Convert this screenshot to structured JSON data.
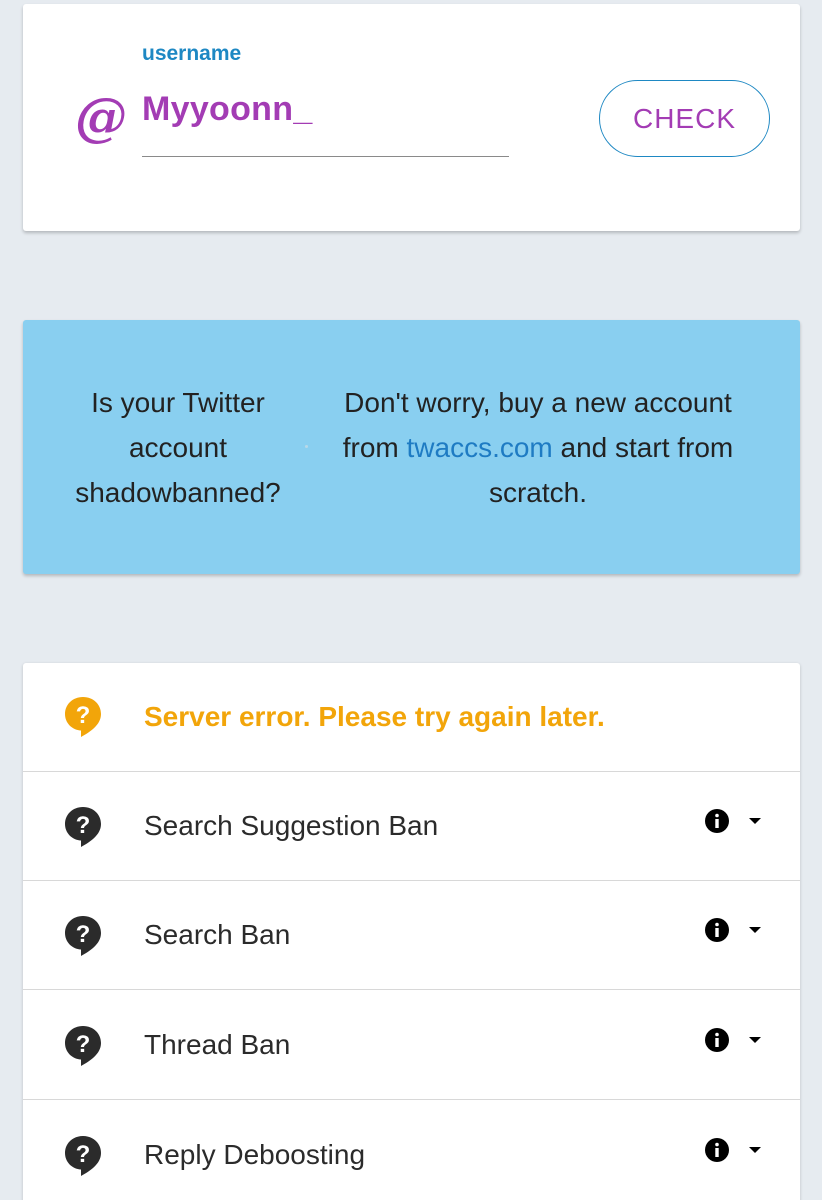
{
  "username_form": {
    "label": "username",
    "value": "Myyoonn_",
    "at_symbol": "@",
    "check_label": "CHECK"
  },
  "ad": {
    "left_text": "Is your Twitter account shadowbanned?",
    "right_text_before": "Don't worry, buy a new account from ",
    "right_link": "twaccs.com",
    "right_text_after": " and start from scratch."
  },
  "results": {
    "status_message": "Server error. Please try again later.",
    "items": [
      {
        "label": "Search Suggestion Ban",
        "icon": "question-bubble-icon"
      },
      {
        "label": "Search Ban",
        "icon": "question-bubble-icon"
      },
      {
        "label": "Thread Ban",
        "icon": "question-bubble-icon"
      },
      {
        "label": "Reply Deboosting",
        "icon": "question-bubble-icon"
      }
    ]
  },
  "colors": {
    "background": "#e6ebf0",
    "accent_purple": "#a33cb4",
    "accent_blue": "#1e88c3",
    "ad_background": "#89cff0",
    "warning_orange": "#f2a50a",
    "neutral_icon": "#2b2b2b"
  }
}
